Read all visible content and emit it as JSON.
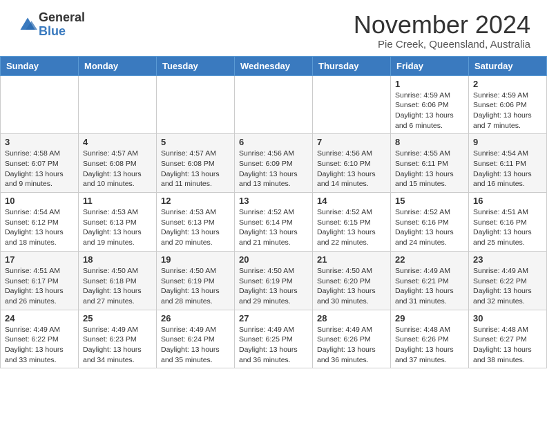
{
  "logo": {
    "general": "General",
    "blue": "Blue"
  },
  "title": "November 2024",
  "subtitle": "Pie Creek, Queensland, Australia",
  "days_of_week": [
    "Sunday",
    "Monday",
    "Tuesday",
    "Wednesday",
    "Thursday",
    "Friday",
    "Saturday"
  ],
  "weeks": [
    [
      {
        "day": "",
        "info": ""
      },
      {
        "day": "",
        "info": ""
      },
      {
        "day": "",
        "info": ""
      },
      {
        "day": "",
        "info": ""
      },
      {
        "day": "",
        "info": ""
      },
      {
        "day": "1",
        "info": "Sunrise: 4:59 AM\nSunset: 6:06 PM\nDaylight: 13 hours and 6 minutes."
      },
      {
        "day": "2",
        "info": "Sunrise: 4:59 AM\nSunset: 6:06 PM\nDaylight: 13 hours and 7 minutes."
      }
    ],
    [
      {
        "day": "3",
        "info": "Sunrise: 4:58 AM\nSunset: 6:07 PM\nDaylight: 13 hours and 9 minutes."
      },
      {
        "day": "4",
        "info": "Sunrise: 4:57 AM\nSunset: 6:08 PM\nDaylight: 13 hours and 10 minutes."
      },
      {
        "day": "5",
        "info": "Sunrise: 4:57 AM\nSunset: 6:08 PM\nDaylight: 13 hours and 11 minutes."
      },
      {
        "day": "6",
        "info": "Sunrise: 4:56 AM\nSunset: 6:09 PM\nDaylight: 13 hours and 13 minutes."
      },
      {
        "day": "7",
        "info": "Sunrise: 4:56 AM\nSunset: 6:10 PM\nDaylight: 13 hours and 14 minutes."
      },
      {
        "day": "8",
        "info": "Sunrise: 4:55 AM\nSunset: 6:11 PM\nDaylight: 13 hours and 15 minutes."
      },
      {
        "day": "9",
        "info": "Sunrise: 4:54 AM\nSunset: 6:11 PM\nDaylight: 13 hours and 16 minutes."
      }
    ],
    [
      {
        "day": "10",
        "info": "Sunrise: 4:54 AM\nSunset: 6:12 PM\nDaylight: 13 hours and 18 minutes."
      },
      {
        "day": "11",
        "info": "Sunrise: 4:53 AM\nSunset: 6:13 PM\nDaylight: 13 hours and 19 minutes."
      },
      {
        "day": "12",
        "info": "Sunrise: 4:53 AM\nSunset: 6:13 PM\nDaylight: 13 hours and 20 minutes."
      },
      {
        "day": "13",
        "info": "Sunrise: 4:52 AM\nSunset: 6:14 PM\nDaylight: 13 hours and 21 minutes."
      },
      {
        "day": "14",
        "info": "Sunrise: 4:52 AM\nSunset: 6:15 PM\nDaylight: 13 hours and 22 minutes."
      },
      {
        "day": "15",
        "info": "Sunrise: 4:52 AM\nSunset: 6:16 PM\nDaylight: 13 hours and 24 minutes."
      },
      {
        "day": "16",
        "info": "Sunrise: 4:51 AM\nSunset: 6:16 PM\nDaylight: 13 hours and 25 minutes."
      }
    ],
    [
      {
        "day": "17",
        "info": "Sunrise: 4:51 AM\nSunset: 6:17 PM\nDaylight: 13 hours and 26 minutes."
      },
      {
        "day": "18",
        "info": "Sunrise: 4:50 AM\nSunset: 6:18 PM\nDaylight: 13 hours and 27 minutes."
      },
      {
        "day": "19",
        "info": "Sunrise: 4:50 AM\nSunset: 6:19 PM\nDaylight: 13 hours and 28 minutes."
      },
      {
        "day": "20",
        "info": "Sunrise: 4:50 AM\nSunset: 6:19 PM\nDaylight: 13 hours and 29 minutes."
      },
      {
        "day": "21",
        "info": "Sunrise: 4:50 AM\nSunset: 6:20 PM\nDaylight: 13 hours and 30 minutes."
      },
      {
        "day": "22",
        "info": "Sunrise: 4:49 AM\nSunset: 6:21 PM\nDaylight: 13 hours and 31 minutes."
      },
      {
        "day": "23",
        "info": "Sunrise: 4:49 AM\nSunset: 6:22 PM\nDaylight: 13 hours and 32 minutes."
      }
    ],
    [
      {
        "day": "24",
        "info": "Sunrise: 4:49 AM\nSunset: 6:22 PM\nDaylight: 13 hours and 33 minutes."
      },
      {
        "day": "25",
        "info": "Sunrise: 4:49 AM\nSunset: 6:23 PM\nDaylight: 13 hours and 34 minutes."
      },
      {
        "day": "26",
        "info": "Sunrise: 4:49 AM\nSunset: 6:24 PM\nDaylight: 13 hours and 35 minutes."
      },
      {
        "day": "27",
        "info": "Sunrise: 4:49 AM\nSunset: 6:25 PM\nDaylight: 13 hours and 36 minutes."
      },
      {
        "day": "28",
        "info": "Sunrise: 4:49 AM\nSunset: 6:26 PM\nDaylight: 13 hours and 36 minutes."
      },
      {
        "day": "29",
        "info": "Sunrise: 4:48 AM\nSunset: 6:26 PM\nDaylight: 13 hours and 37 minutes."
      },
      {
        "day": "30",
        "info": "Sunrise: 4:48 AM\nSunset: 6:27 PM\nDaylight: 13 hours and 38 minutes."
      }
    ]
  ]
}
